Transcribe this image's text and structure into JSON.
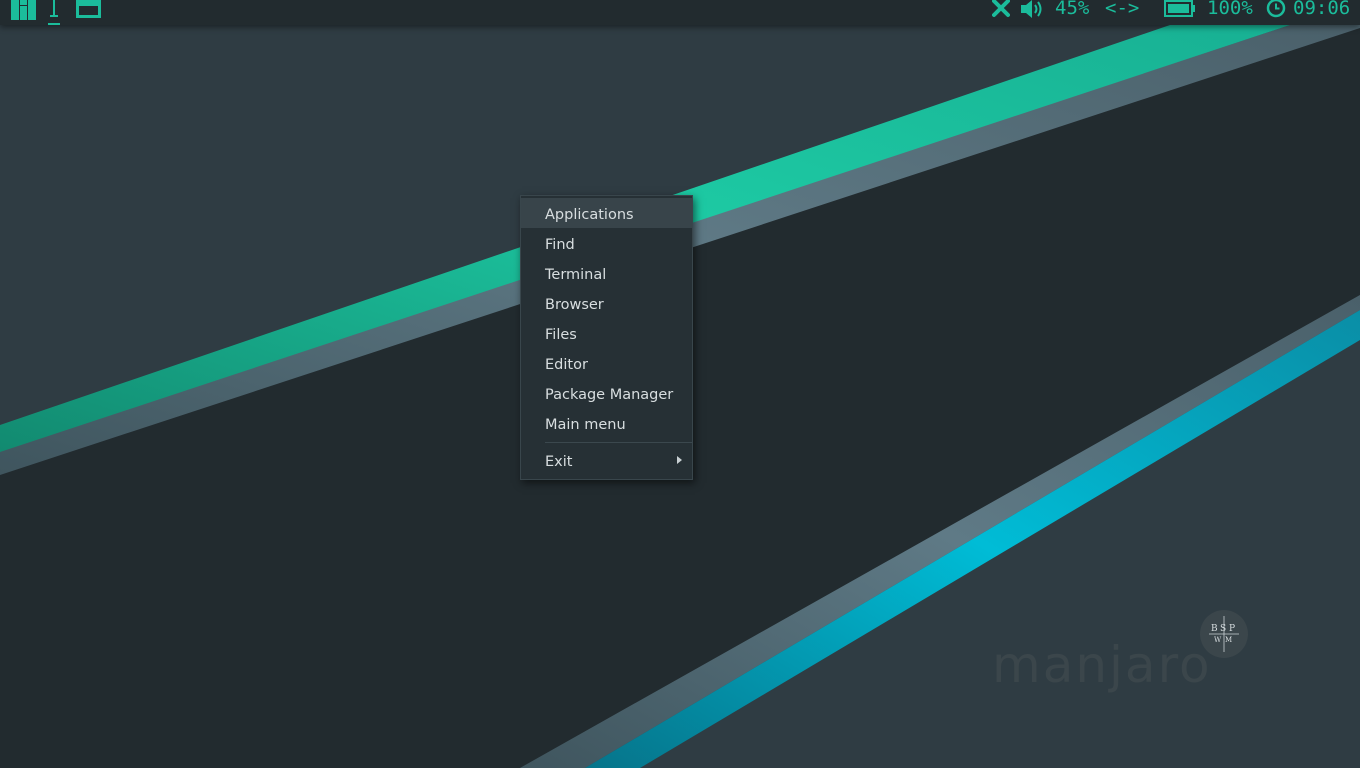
{
  "panel": {
    "volume_text": "45%",
    "network_text": "<->",
    "battery_text": "100%",
    "clock_text": "09:06",
    "icons": [
      "manjaro-icon",
      "text-cursor-icon",
      "window-icon",
      "close-x-icon",
      "speaker-icon",
      "battery-icon",
      "clock-icon"
    ],
    "accent": "#1bbc9b"
  },
  "menu": {
    "items": [
      {
        "label": "Applications"
      },
      {
        "label": "Find"
      },
      {
        "label": "Terminal"
      },
      {
        "label": "Browser"
      },
      {
        "label": "Files"
      },
      {
        "label": "Editor"
      },
      {
        "label": "Package Manager"
      },
      {
        "label": "Main menu"
      },
      {
        "label": "Exit"
      }
    ]
  },
  "logo": {
    "wordmark": "manjaro",
    "badge_letters": [
      "B",
      "S",
      "P",
      "W",
      "M"
    ]
  },
  "colors": {
    "background": "#222b2f",
    "green_stripe": "#1bbc9b",
    "cyan_stripe": "#00b4cc",
    "grey_stripe": "#55707c"
  }
}
